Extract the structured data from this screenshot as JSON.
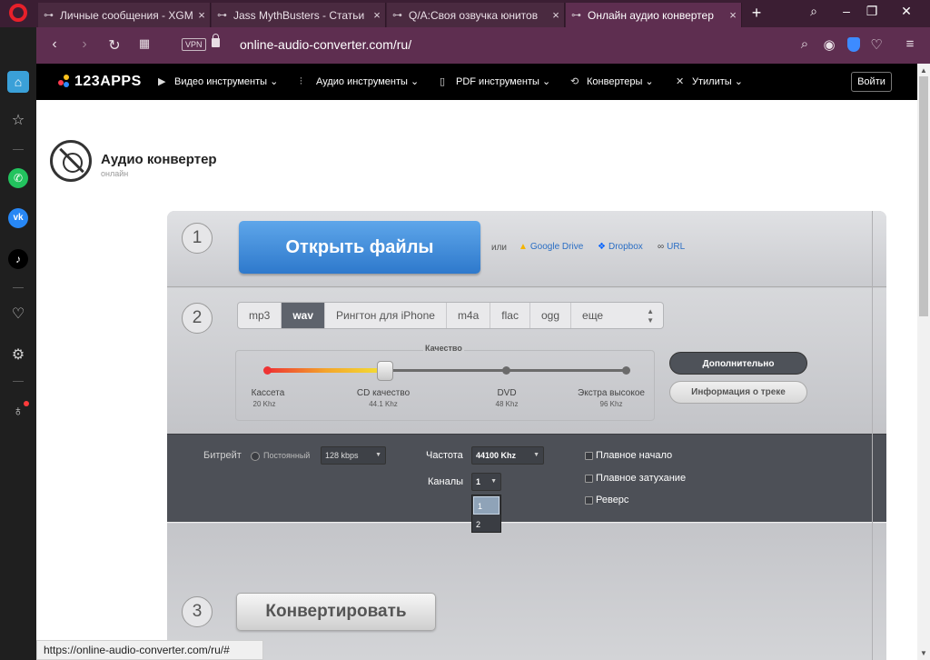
{
  "browser": {
    "tabs": [
      {
        "title": "Личные сообщения - XGM"
      },
      {
        "title": "Jass MythBusters - Статьи"
      },
      {
        "title": "Q/A:Своя озвучка юнитов"
      },
      {
        "title": "Онлайн аудио конвертер"
      }
    ],
    "vpn_label": "VPN",
    "url": "online-audio-converter.com/ru/",
    "status_url": "https://online-audio-converter.com/ru/#"
  },
  "site": {
    "logo": "123APPS",
    "nav": [
      {
        "label": "Видео инструменты"
      },
      {
        "label": "Аудио инструменты"
      },
      {
        "label": "PDF инструменты"
      },
      {
        "label": "Конвертеры"
      },
      {
        "label": "Утилиты"
      }
    ],
    "login": "Войти",
    "colors": {
      "brand_blue": "#2e79cc",
      "dark_panel": "#4d5057"
    }
  },
  "app": {
    "title": "Аудио конвертер",
    "subtitle": "онлайн"
  },
  "step1": {
    "num": "1",
    "open_button": "Открыть файлы",
    "or": "или",
    "sources": [
      {
        "label": "Google Drive"
      },
      {
        "label": "Dropbox"
      },
      {
        "label": "URL"
      }
    ]
  },
  "step2": {
    "num": "2",
    "formats": [
      {
        "label": "mp3"
      },
      {
        "label": "wav"
      },
      {
        "label": "Рингтон для iPhone"
      },
      {
        "label": "m4a"
      },
      {
        "label": "flac"
      },
      {
        "label": "ogg"
      },
      {
        "label": "еще"
      }
    ],
    "selected_format": "wav",
    "quality": {
      "title": "Качество",
      "levels": [
        {
          "label": "Кассета",
          "khz": "20 Khz"
        },
        {
          "label": "CD качество",
          "khz": "44.1 Khz"
        },
        {
          "label": "DVD",
          "khz": "48 Khz"
        },
        {
          "label": "Экстра высокое",
          "khz": "96 Khz"
        }
      ],
      "selected_level": 1
    },
    "advanced_button": "Дополнительно",
    "info_button": "Информация о треке"
  },
  "advanced": {
    "bitrate_label": "Битрейт",
    "constant_label": "Постоянный",
    "bitrate_value": "128 kbps",
    "frequency_label": "Частота",
    "frequency_value": "44100 Khz",
    "channels_label": "Каналы",
    "channels_value": "1",
    "channel_options": [
      "1",
      "2"
    ],
    "fade_in": "Плавное начало",
    "fade_out": "Плавное затухание",
    "reverse": "Реверс"
  },
  "step3": {
    "num": "3",
    "convert_button": "Конвертировать"
  }
}
